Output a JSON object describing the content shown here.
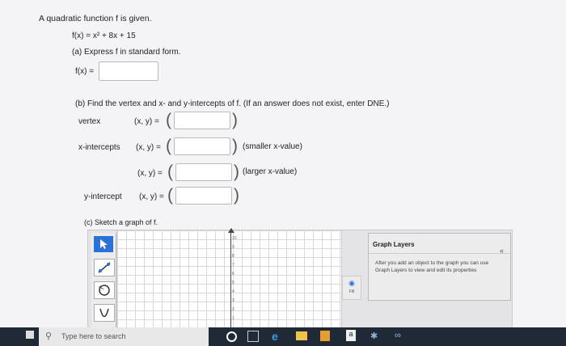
{
  "problem": {
    "intro": "A quadratic function f is given.",
    "function": "f(x) = x² + 8x + 15",
    "part_a": "(a) Express f in standard form.",
    "fx_label": "f(x) =",
    "part_b": "(b) Find the vertex and x- and y-intercepts of f. (If an answer does not exist, enter DNE.)",
    "vertex_label": "vertex",
    "xint_label": "x-intercepts",
    "yint_label": "y-intercept",
    "xy_eq": "(x, y) =",
    "smaller_note": "(smaller x-value)",
    "larger_note": "(larger x-value)",
    "part_c": "(c) Sketch a graph of f."
  },
  "graph_tool": {
    "y_ticks": [
      "10",
      "9",
      "8",
      "7",
      "6",
      "5",
      "4",
      "3",
      "2",
      "1"
    ],
    "fill_label": "Fill",
    "panel_title": "Graph Layers",
    "panel_collapse": "«",
    "panel_text": "After you add an object to the graph you can use Graph Layers to view and edit its properties",
    "tools": [
      "pointer-tool",
      "line-tool",
      "circle-tool",
      "parabola-tool"
    ]
  },
  "taskbar": {
    "search_placeholder": "Type here to search"
  },
  "colors": {
    "accent_blue": "#2a72d8",
    "taskbar": "#1f2a36"
  }
}
